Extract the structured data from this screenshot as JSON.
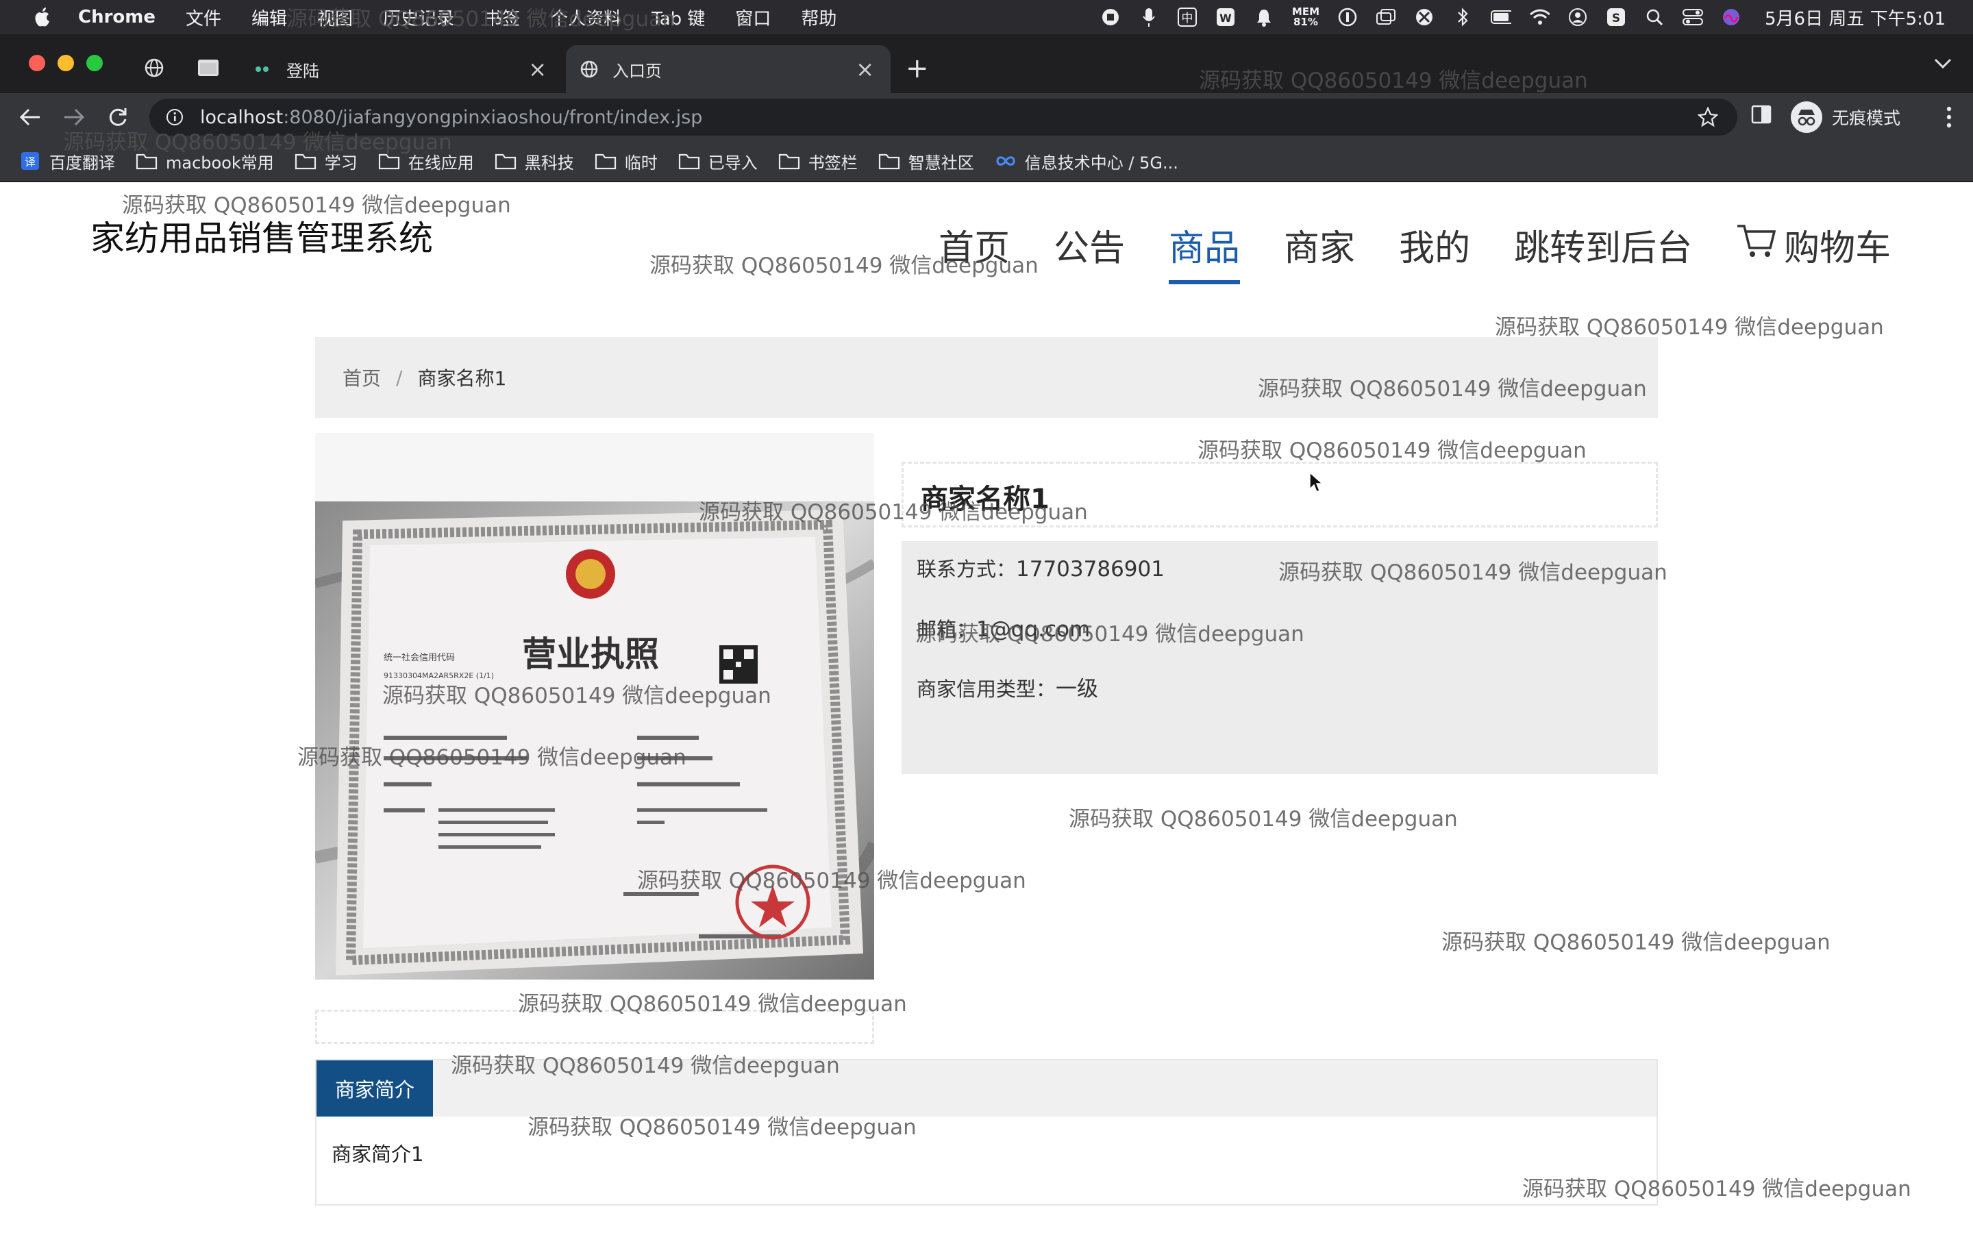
{
  "menubar": {
    "app": "Chrome",
    "items": [
      "文件",
      "编辑",
      "视图",
      "历史记录",
      "书签",
      "个人资料",
      "Tab 键",
      "窗口",
      "帮助"
    ],
    "mem_label": "MEM",
    "mem_value": "81%",
    "clock": "5月6日 周五 下午5:01"
  },
  "tabs": [
    {
      "title": "登陆"
    },
    {
      "title": "入口页"
    }
  ],
  "address": {
    "host": "localhost",
    "path": ":8080/jiafangyongpinxiaoshou/front/index.jsp"
  },
  "profile": {
    "label": "无痕模式"
  },
  "bookmarks": [
    "百度翻译",
    "macbook常用",
    "学习",
    "在线应用",
    "黑科技",
    "临时",
    "已导入",
    "书签栏",
    "智慧社区",
    "信息技术中心 / 5G..."
  ],
  "site": {
    "title": "家纺用品销售管理系统",
    "nav": [
      "首页",
      "公告",
      "商品",
      "商家",
      "我的",
      "跳转到后台"
    ],
    "cart": "购物车"
  },
  "breadcrumb": {
    "home": "首页",
    "sep": "/",
    "current": "商家名称1"
  },
  "merchant": {
    "name": "商家名称1",
    "phone_label": "联系方式：",
    "phone": "17703786901",
    "email_label": "邮箱：",
    "email": "1@qq.com",
    "credit_label": "商家信用类型：",
    "credit": "一级"
  },
  "license_image": {
    "heading": "营业执照",
    "code_label": "统一社会信用代码",
    "code": "91330304MA2AR5RX2E (1/1)"
  },
  "intro_tab": {
    "label": "商家简介",
    "content": "商家简介1"
  },
  "watermark": "源码获取 QQ86050149 微信deepguan"
}
